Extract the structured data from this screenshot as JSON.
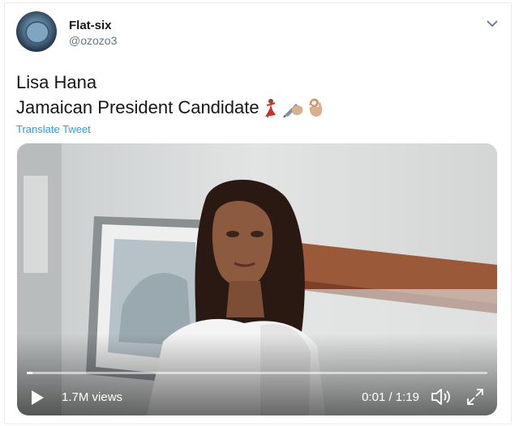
{
  "author": {
    "display_name": "Flat-six",
    "handle": "@ozozo3",
    "avatar_icon": "globe-avatar-icon"
  },
  "tweet": {
    "line1": "Lisa Hana",
    "line2": "Jamaican President Candidate",
    "emojis": [
      "dancer-emoji",
      "writing-hand-emoji",
      "ok-hand-emoji"
    ],
    "translate_label": "Translate Tweet"
  },
  "video": {
    "views": "1.7M views",
    "time": "0:01 / 1:19",
    "progress_fraction": 0.013
  },
  "colors": {
    "link": "#1da1f2",
    "text": "#14171a",
    "muted": "#657786"
  }
}
